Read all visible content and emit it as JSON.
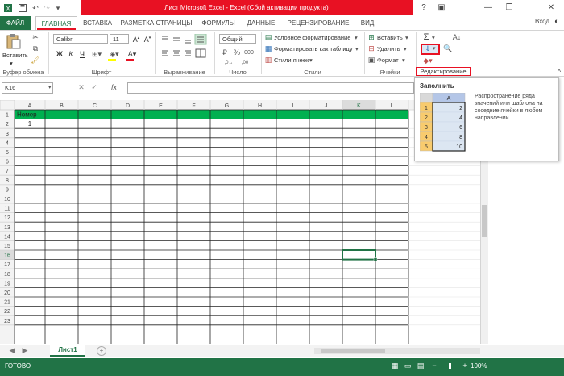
{
  "title": {
    "window_title": "Лист Microsoft Excel - Excel (Сбой активации продукта)",
    "signin": "Вход"
  },
  "tabs": [
    {
      "label": "ФАЙЛ"
    },
    {
      "label": "ГЛАВНАЯ"
    },
    {
      "label": "ВСТАВКА"
    },
    {
      "label": "РАЗМЕТКА СТРАНИЦЫ"
    },
    {
      "label": "ФОРМУЛЫ"
    },
    {
      "label": "ДАННЫЕ"
    },
    {
      "label": "РЕЦЕНЗИРОВАНИЕ"
    },
    {
      "label": "ВИД"
    }
  ],
  "ribbon": {
    "clipboard": {
      "label": "Буфер обмена",
      "paste": "Вставить"
    },
    "font": {
      "label": "Шрифт",
      "font_name": "Calibri",
      "font_size": "11",
      "bold": "Ж",
      "italic": "К",
      "underline": "Ч"
    },
    "alignment": {
      "label": "Выравнивание"
    },
    "number": {
      "label": "Число",
      "format": "Общий"
    },
    "styles": {
      "label": "Стили",
      "conditional": "Условное форматирование",
      "as_table": "Форматировать как таблицу",
      "cell_styles": "Стили ячеек"
    },
    "cells": {
      "label": "Ячейки",
      "insert": "Вставить",
      "delete": "Удалить",
      "format": "Формат"
    },
    "editing": {
      "label": "Редактирование"
    }
  },
  "formula_bar": {
    "name_box": "K16",
    "fx": "fx",
    "value": ""
  },
  "grid": {
    "columns": [
      "A",
      "B",
      "C",
      "D",
      "E",
      "F",
      "G",
      "H",
      "I",
      "J",
      "K",
      "L"
    ],
    "rows": [
      "1",
      "2",
      "3",
      "4",
      "5",
      "6",
      "7",
      "8",
      "9",
      "10",
      "11",
      "12",
      "13",
      "14",
      "15",
      "16",
      "17",
      "18",
      "19",
      "20",
      "21",
      "22",
      "23"
    ],
    "selected_cell": "K16",
    "cells": {
      "A1": "Номер",
      "A2": "1"
    },
    "header_fill_color": "#00b050"
  },
  "tooltip": {
    "title": "Заполнить",
    "description": "Распространение ряда значений или шаблона на соседние ячейки в любом направлении.",
    "preview_col": "A",
    "preview_rows": [
      "1",
      "2",
      "3",
      "4",
      "5"
    ],
    "preview_values": [
      "2",
      "4",
      "6",
      "8",
      "10"
    ]
  },
  "sheets": [
    {
      "name": "Лист1"
    }
  ],
  "status": {
    "ready": "ГОТОВО",
    "zoom": "100%"
  },
  "colors": {
    "excel_green": "#217346",
    "title_red": "#e81123",
    "highlight_red": "#e81123"
  }
}
